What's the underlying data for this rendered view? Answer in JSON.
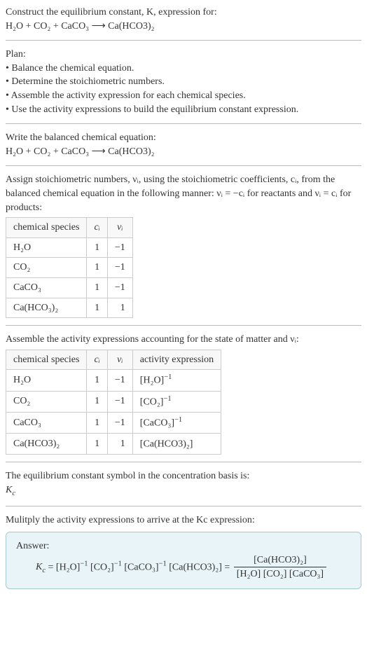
{
  "intro": {
    "line1": "Construct the equilibrium constant, K, expression for:",
    "equation": "H₂O + CO₂ + CaCO₃  ⟶  Ca(HCO3)₂"
  },
  "plan": {
    "title": "Plan:",
    "b1": "• Balance the chemical equation.",
    "b2": "• Determine the stoichiometric numbers.",
    "b3": "• Assemble the activity expression for each chemical species.",
    "b4": "• Use the activity expressions to build the equilibrium constant expression."
  },
  "balanced": {
    "title": "Write the balanced chemical equation:",
    "equation": "H₂O + CO₂ + CaCO₃  ⟶  Ca(HCO3)₂"
  },
  "assign": {
    "text1": "Assign stoichiometric numbers, νᵢ, using the stoichiometric coefficients, cᵢ, from the balanced chemical equation in the following manner: νᵢ = −cᵢ for reactants and νᵢ = cᵢ for products:",
    "headers": {
      "h0": "chemical species",
      "h1": "cᵢ",
      "h2": "νᵢ"
    },
    "rows": [
      {
        "name": "H₂O",
        "c": "1",
        "v": "−1"
      },
      {
        "name": "CO₂",
        "c": "1",
        "v": "−1"
      },
      {
        "name": "CaCO₃",
        "c": "1",
        "v": "−1"
      },
      {
        "name": "Ca(HCO₃)₂",
        "c": "1",
        "v": "1"
      }
    ]
  },
  "activity": {
    "text": "Assemble the activity expressions accounting for the state of matter and νᵢ:",
    "headers": {
      "h0": "chemical species",
      "h1": "cᵢ",
      "h2": "νᵢ",
      "h3": "activity expression"
    },
    "rows": [
      {
        "name": "H₂O",
        "c": "1",
        "v": "−1",
        "expr_base": "[H₂O]",
        "expr_pow": "−1"
      },
      {
        "name": "CO₂",
        "c": "1",
        "v": "−1",
        "expr_base": "[CO₂]",
        "expr_pow": "−1"
      },
      {
        "name": "CaCO₃",
        "c": "1",
        "v": "−1",
        "expr_base": "[CaCO₃]",
        "expr_pow": "−1"
      },
      {
        "name": "Ca(HCO3)₂",
        "c": "1",
        "v": "1",
        "expr_base": "[Ca(HCO3)₂]",
        "expr_pow": ""
      }
    ]
  },
  "symbol": {
    "text": "The equilibrium constant symbol in the concentration basis is:",
    "sym": "K",
    "sub": "c"
  },
  "multiply": {
    "text": "Mulitply the activity expressions to arrive at the Kc expression:"
  },
  "answer": {
    "label": "Answer:",
    "lhs": "Kc = ",
    "p1b": "[H₂O]",
    "p1p": "−1",
    "p2b": " [CO₂]",
    "p2p": "−1",
    "p3b": " [CaCO₃]",
    "p3p": "−1",
    "p4": " [Ca(HCO3)₂] = ",
    "num": "[Ca(HCO3)₂]",
    "den": "[H₂O] [CO₂] [CaCO₃]"
  }
}
